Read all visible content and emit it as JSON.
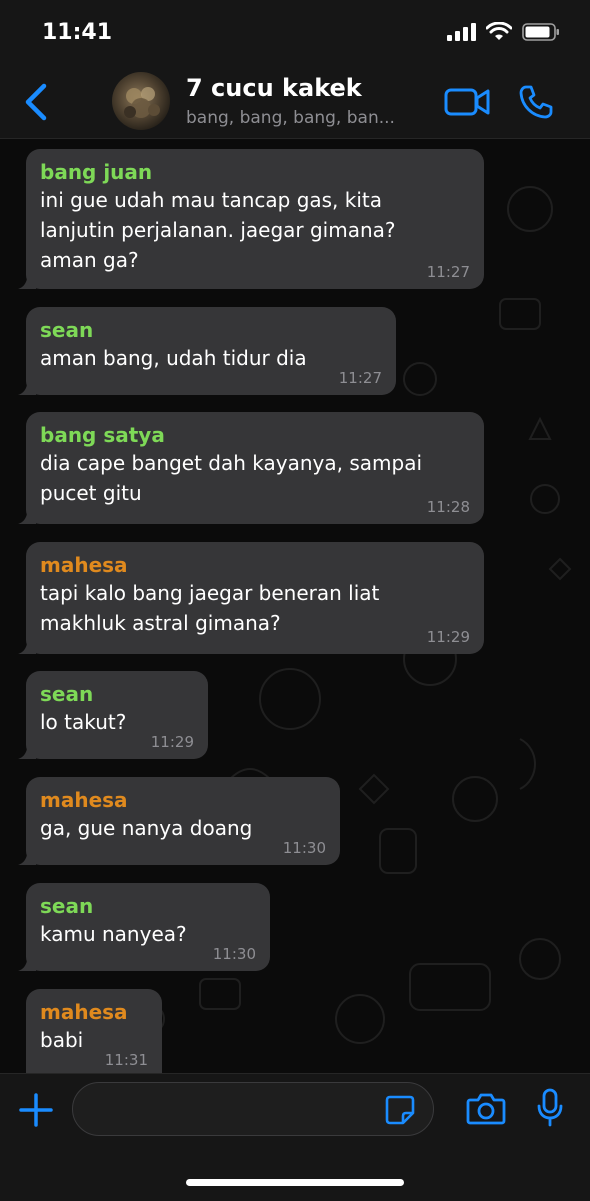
{
  "status_bar": {
    "time": "11:41"
  },
  "header": {
    "title": "7 cucu kakek",
    "subtitle": "bang, bang, bang, ban..."
  },
  "colors": {
    "accent": "#1a8cff",
    "bubble": "#363638",
    "name_green": "#7ed957",
    "name_orange": "#e08a1e",
    "timestamp": "#8e8e93"
  },
  "messages": [
    {
      "sender": "bang juan",
      "text": "ini gue udah mau tancap gas, kita\nlanjutin perjalanan. jaegar gimana?\naman ga?",
      "time": "11:27"
    },
    {
      "sender": "sean",
      "text": "aman bang, udah tidur dia",
      "time": "11:27"
    },
    {
      "sender": "bang satya",
      "text": "dia cape banget dah kayanya, sampai\npucet gitu",
      "time": "11:28"
    },
    {
      "sender": "mahesa",
      "text": "tapi kalo bang jaegar beneran liat\nmakhluk astral gimana?",
      "time": "11:29"
    },
    {
      "sender": "sean",
      "text": "lo takut?",
      "time": "11:29"
    },
    {
      "sender": "mahesa",
      "text": "ga, gue nanya doang",
      "time": "11:30"
    },
    {
      "sender": "sean",
      "text": "kamu nanyea?",
      "time": "11:30"
    },
    {
      "sender": "mahesa",
      "text": "babi",
      "time": "11:31"
    }
  ],
  "input": {
    "value": "",
    "placeholder": ""
  },
  "icons": {
    "back": "chevron-left-icon",
    "video": "video-call-icon",
    "call": "phone-icon",
    "plus": "plus-icon",
    "sticker": "sticker-icon",
    "camera": "camera-icon",
    "mic": "microphone-icon"
  }
}
